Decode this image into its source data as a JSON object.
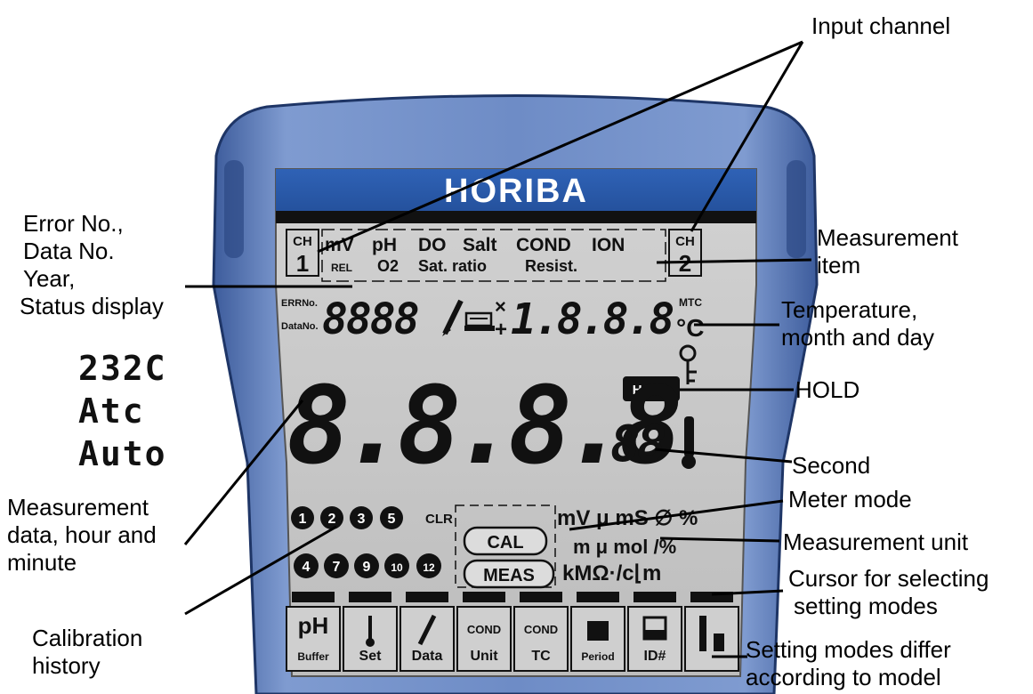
{
  "brand": "HORIBA",
  "callouts": {
    "input_channel": "Input channel",
    "error_no": [
      "Error No.,",
      "Data No.",
      "Year,",
      "Status display"
    ],
    "measurement_item": [
      "Measurement",
      "item"
    ],
    "temperature": [
      "Temperature,",
      "month and day"
    ],
    "hold": "HOLD",
    "second": "Second",
    "meter_mode": "Meter mode",
    "measurement_unit": "Measurement unit",
    "measurement_data": [
      "Measurement",
      "data, hour and",
      "minute"
    ],
    "cursor": [
      "Cursor for selecting",
      "setting modes"
    ],
    "calibration": [
      "Calibration",
      "history"
    ],
    "setting_modes": [
      "Setting modes differ",
      "according to model"
    ]
  },
  "status_examples": [
    "232C",
    "Atc",
    "Auto"
  ],
  "lcd": {
    "ch_label": "CH",
    "ch1": "1",
    "ch2": "2",
    "items_top": [
      "mV",
      "pH",
      "DO",
      "Salt",
      "COND",
      "ION"
    ],
    "items_bottom": [
      "REL",
      "O2",
      "Sat. ratio",
      "Resist."
    ],
    "err_label": "ERRNo.",
    "data_label": "DataNo.",
    "small_digits": "8888",
    "temp_digits": "1.8.8.8",
    "mtc": "MTC",
    "deg_c": "°C",
    "hold_badge": "HOLD",
    "main_digits": "8.8.8.8",
    "seconds_digits": "88",
    "cal_numbers_top": [
      "1",
      "2",
      "3",
      "5"
    ],
    "cal_numbers_bottom": [
      "4",
      "7",
      "9",
      "10",
      "12"
    ],
    "clr": "CLR",
    "cal_btn": "CAL",
    "meas_btn": "MEAS",
    "units_row1": "mV μ mS ∅ %",
    "units_row2": "m μ mol /%",
    "units_row3": "kMΩ·/c⌊m",
    "tabs": [
      {
        "top": "pH",
        "bottom": "Buffer"
      },
      {
        "top": "",
        "bottom": "Set"
      },
      {
        "top": "",
        "bottom": "Data"
      },
      {
        "top": "COND",
        "bottom": "Unit"
      },
      {
        "top": "COND",
        "bottom": "TC"
      },
      {
        "top": "",
        "bottom": "Period"
      },
      {
        "top": "",
        "bottom": "ID#"
      },
      {
        "top": "",
        "bottom": ""
      }
    ]
  },
  "colors": {
    "case_blue": "#5b79b4",
    "case_dark": "#2f4d8a",
    "screen_grey": "#c9c9c9",
    "brand_bar": "#2c5aa8"
  }
}
